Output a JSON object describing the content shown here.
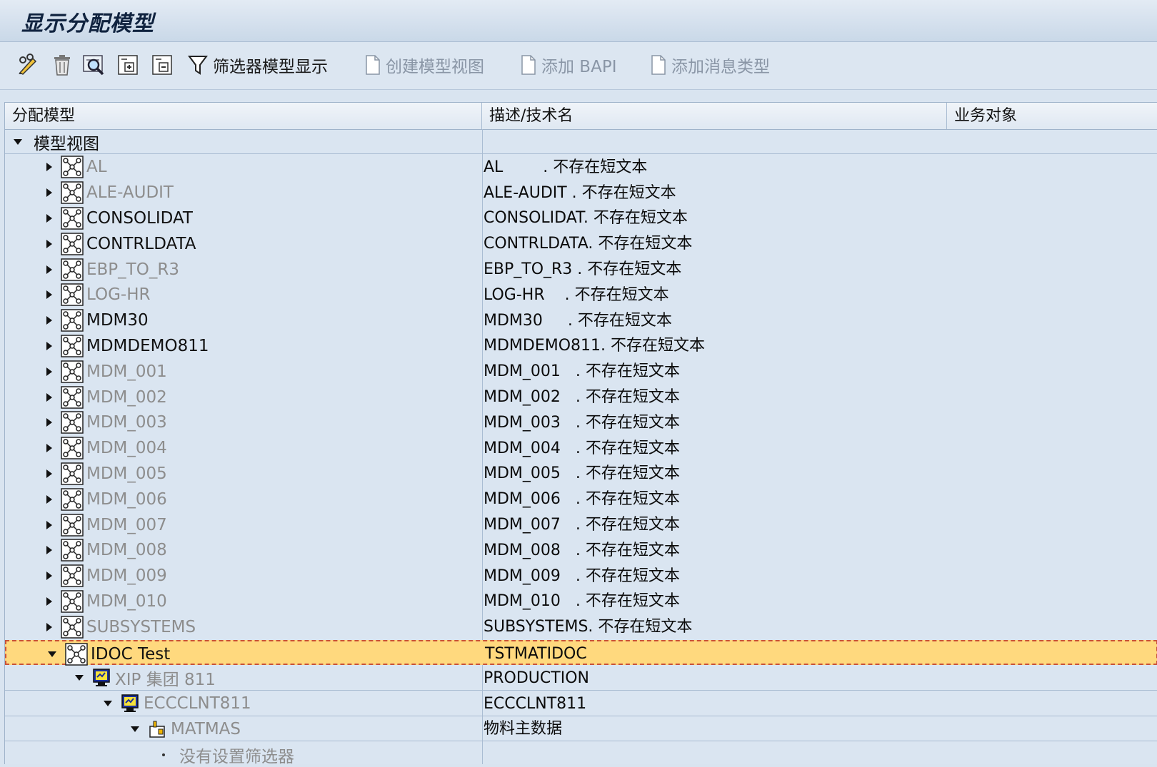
{
  "window": {
    "title": "显示分配模型"
  },
  "toolbar": {
    "filter_label": "筛选器模型显示",
    "create_view_label": "创建模型视图",
    "add_bapi_label": "添加 BAPI",
    "add_msgtype_label": "添加消息类型"
  },
  "columns": {
    "col1": "分配模型",
    "col2": "描述/技术名",
    "col3": "业务对象"
  },
  "root": {
    "label": "模型视图"
  },
  "models": [
    {
      "name": "AL",
      "desc": "AL        . 不存在短文本",
      "active": false
    },
    {
      "name": "ALE-AUDIT",
      "desc": "ALE-AUDIT . 不存在短文本",
      "active": false
    },
    {
      "name": "CONSOLIDAT",
      "desc": "CONSOLIDAT. 不存在短文本",
      "active": true
    },
    {
      "name": "CONTRLDATA",
      "desc": "CONTRLDATA. 不存在短文本",
      "active": true
    },
    {
      "name": "EBP_TO_R3",
      "desc": "EBP_TO_R3 . 不存在短文本",
      "active": false
    },
    {
      "name": "LOG-HR",
      "desc": "LOG-HR    . 不存在短文本",
      "active": false
    },
    {
      "name": "MDM30",
      "desc": "MDM30     . 不存在短文本",
      "active": true
    },
    {
      "name": "MDMDEMO811",
      "desc": "MDMDEMO811. 不存在短文本",
      "active": true
    },
    {
      "name": "MDM_001",
      "desc": "MDM_001   . 不存在短文本",
      "active": false
    },
    {
      "name": "MDM_002",
      "desc": "MDM_002   . 不存在短文本",
      "active": false
    },
    {
      "name": "MDM_003",
      "desc": "MDM_003   . 不存在短文本",
      "active": false
    },
    {
      "name": "MDM_004",
      "desc": "MDM_004   . 不存在短文本",
      "active": false
    },
    {
      "name": "MDM_005",
      "desc": "MDM_005   . 不存在短文本",
      "active": false
    },
    {
      "name": "MDM_006",
      "desc": "MDM_006   . 不存在短文本",
      "active": false
    },
    {
      "name": "MDM_007",
      "desc": "MDM_007   . 不存在短文本",
      "active": false
    },
    {
      "name": "MDM_008",
      "desc": "MDM_008   . 不存在短文本",
      "active": false
    },
    {
      "name": "MDM_009",
      "desc": "MDM_009   . 不存在短文本",
      "active": false
    },
    {
      "name": "MDM_010",
      "desc": "MDM_010   . 不存在短文本",
      "active": false
    },
    {
      "name": "SUBSYSTEMS",
      "desc": "SUBSYSTEMS. 不存在短文本",
      "active": false
    }
  ],
  "selected": {
    "name": "IDOC Test",
    "desc": "TSTMATIDOC"
  },
  "children": [
    {
      "name": "XIP 集团 811",
      "desc": "PRODUCTION"
    },
    {
      "name": "ECCCLNT811",
      "desc": "ECCCLNT811"
    },
    {
      "name": "MATMAS",
      "desc": "物料主数据"
    },
    {
      "name": "没有设置筛选器",
      "desc": ""
    }
  ],
  "colors": {
    "highlight": "#ffd97e",
    "grid_bg": "#dae5f1",
    "disabled_text": "#8d8d8d"
  }
}
